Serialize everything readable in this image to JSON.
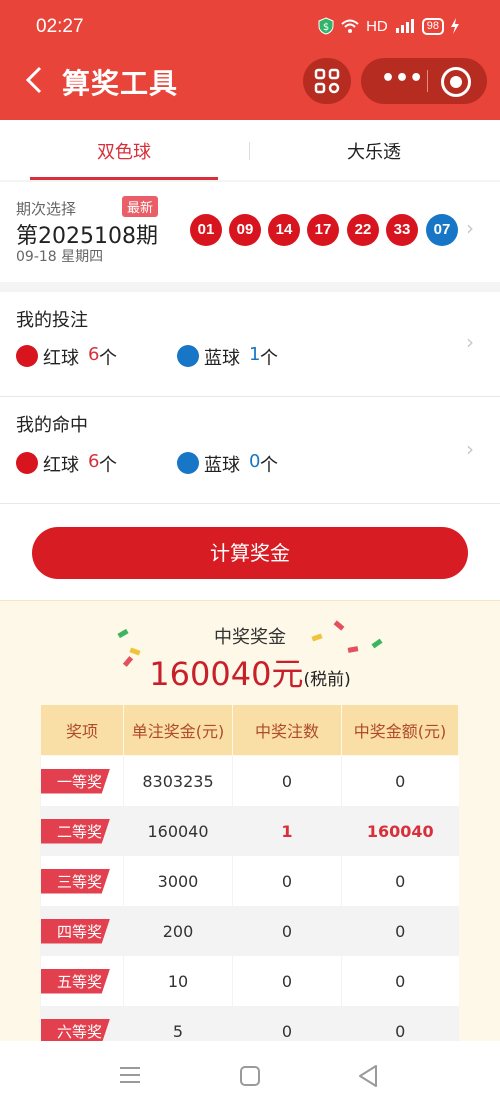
{
  "status": {
    "time": "02:27",
    "signal": "HD",
    "battery": "98"
  },
  "header": {
    "title": "算奖工具"
  },
  "tabs": [
    {
      "label": "双色球"
    },
    {
      "label": "大乐透"
    }
  ],
  "period": {
    "label": "期次选择",
    "badge": "最新",
    "number": "第2025108期",
    "date": "09-18 星期四",
    "red_balls": [
      "01",
      "09",
      "14",
      "17",
      "22",
      "33"
    ],
    "blue_balls": [
      "07"
    ]
  },
  "my_bet": {
    "title": "我的投注",
    "red_label": "红球",
    "red_count": "6",
    "blue_label": "蓝球",
    "blue_count": "1",
    "unit": "个"
  },
  "my_hit": {
    "title": "我的命中",
    "red_label": "红球",
    "red_count": "6",
    "blue_label": "蓝球",
    "blue_count": "0",
    "unit": "个"
  },
  "calc_button": "计算奖金",
  "prize": {
    "title": "中奖奖金",
    "amount": "160040元",
    "note": "(税前)",
    "headers": [
      "奖项",
      "单注奖金(元)",
      "中奖注数",
      "中奖金额(元)"
    ],
    "rows": [
      {
        "level": "一等奖",
        "single": "8303235",
        "count": "0",
        "total": "0"
      },
      {
        "level": "二等奖",
        "single": "160040",
        "count": "1",
        "total": "160040"
      },
      {
        "level": "三等奖",
        "single": "3000",
        "count": "0",
        "total": "0"
      },
      {
        "level": "四等奖",
        "single": "200",
        "count": "0",
        "total": "0"
      },
      {
        "level": "五等奖",
        "single": "10",
        "count": "0",
        "total": "0"
      },
      {
        "level": "六等奖",
        "single": "5",
        "count": "0",
        "total": "0"
      }
    ]
  },
  "colors": {
    "header": "#e9443a",
    "accent": "#d8303a",
    "red_ball": "#d8151f",
    "blue_ball": "#1777c6",
    "panel": "#fdf8e8"
  }
}
